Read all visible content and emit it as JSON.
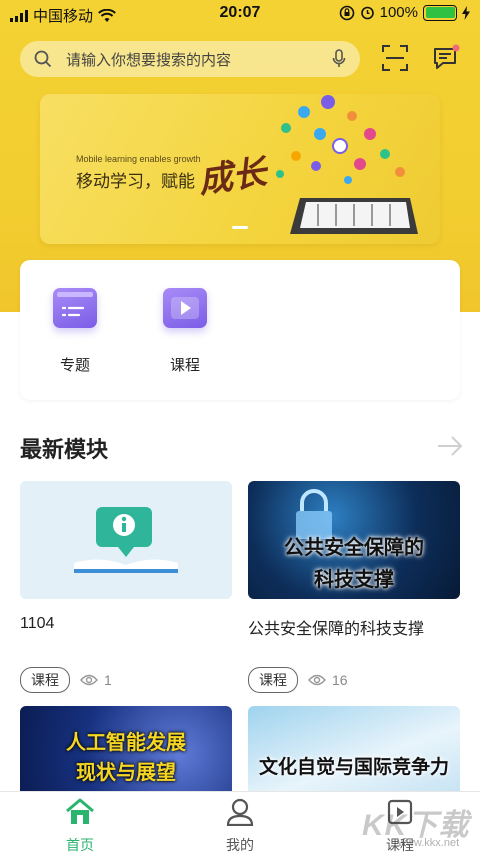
{
  "status_bar": {
    "carrier": "中国移动",
    "time": "20:07",
    "battery": "100%",
    "battery_level": 1.0
  },
  "search": {
    "placeholder": "请输入你想要搜索的内容"
  },
  "icons": {
    "search": "search-icon",
    "mic": "mic-icon",
    "scan": "scan-icon",
    "message": "message-icon"
  },
  "banner": {
    "english_line": "Mobile learning enables growth",
    "chinese_line": "移动学习，赋能",
    "calligraphy": "成长"
  },
  "quick_links": [
    {
      "label": "专题",
      "icon": "topic-icon"
    },
    {
      "label": "课程",
      "icon": "play-video-icon"
    }
  ],
  "section": {
    "title": "最新模块"
  },
  "cards": [
    {
      "title": "1104",
      "tag": "课程",
      "views": "1",
      "thumb_text": []
    },
    {
      "title": "公共安全保障的科技支撑",
      "tag": "课程",
      "views": "16",
      "thumb_text": [
        "公共安全保障的",
        "科技支撑"
      ]
    },
    {
      "title": "",
      "tag": "",
      "views": "",
      "thumb_text": [
        "人工智能发展",
        "现状与展望"
      ]
    },
    {
      "title": "",
      "tag": "",
      "views": "",
      "thumb_text": [
        "文化自觉与国际竞争力"
      ]
    }
  ],
  "tabbar": [
    {
      "label": "首页",
      "icon": "home-icon",
      "active": true
    },
    {
      "label": "我的",
      "icon": "user-icon",
      "active": false
    },
    {
      "label": "课程",
      "icon": "course-icon",
      "active": false
    }
  ],
  "watermark": {
    "text": "KK下载",
    "url": "www.kkx.net"
  },
  "colors": {
    "accent": "#2ab56f",
    "header_yellow": "#f2cd30",
    "purple_icon": "#7a5de6"
  }
}
